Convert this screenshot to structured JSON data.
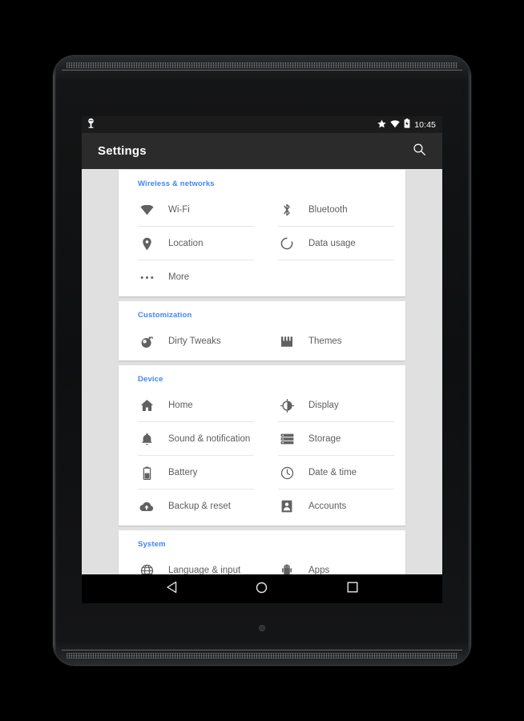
{
  "device": {
    "camera": "front-camera",
    "sensor": "home-sensor"
  },
  "status_bar": {
    "left_icons": [
      "debug-droid-icon"
    ],
    "right_icons": [
      "star-icon",
      "wifi-icon",
      "battery-icon"
    ],
    "clock": "10:45"
  },
  "app_bar": {
    "title": "Settings",
    "search_icon": "search-icon"
  },
  "sections": [
    {
      "header": "Wireless & networks",
      "items": [
        {
          "label": "Wi-Fi",
          "icon": "wifi-icon"
        },
        {
          "label": "Bluetooth",
          "icon": "bluetooth-icon"
        },
        {
          "label": "Location",
          "icon": "location-pin-icon"
        },
        {
          "label": "Data usage",
          "icon": "data-usage-icon"
        },
        {
          "label": "More",
          "icon": "more-dots-icon"
        }
      ]
    },
    {
      "header": "Customization",
      "items": [
        {
          "label": "Dirty Tweaks",
          "icon": "bomb-icon"
        },
        {
          "label": "Themes",
          "icon": "crown-icon"
        }
      ]
    },
    {
      "header": "Device",
      "items": [
        {
          "label": "Home",
          "icon": "home-icon"
        },
        {
          "label": "Display",
          "icon": "brightness-icon"
        },
        {
          "label": "Sound & notification",
          "icon": "bell-icon"
        },
        {
          "label": "Storage",
          "icon": "storage-icon"
        },
        {
          "label": "Battery",
          "icon": "battery-icon"
        },
        {
          "label": "Date & time",
          "icon": "clock-icon"
        },
        {
          "label": "Backup & reset",
          "icon": "cloud-upload-icon"
        },
        {
          "label": "Accounts",
          "icon": "account-icon"
        }
      ]
    },
    {
      "header": "System",
      "items": [
        {
          "label": "Language & input",
          "icon": "globe-icon"
        },
        {
          "label": "Apps",
          "icon": "android-icon"
        }
      ]
    }
  ],
  "nav_bar": {
    "buttons": [
      {
        "name": "back-button",
        "icon": "triangle-back-icon"
      },
      {
        "name": "home-button",
        "icon": "circle-home-icon"
      },
      {
        "name": "recents-button",
        "icon": "square-recents-icon"
      }
    ]
  },
  "colors": {
    "accent": "#4285f4",
    "app_bar": "#2b2b2b",
    "status_bar": "#1b1b1b",
    "page_background": "#e0e0e0",
    "card": "#ffffff",
    "label_text": "#5e5e5e",
    "icon": "#616161"
  }
}
